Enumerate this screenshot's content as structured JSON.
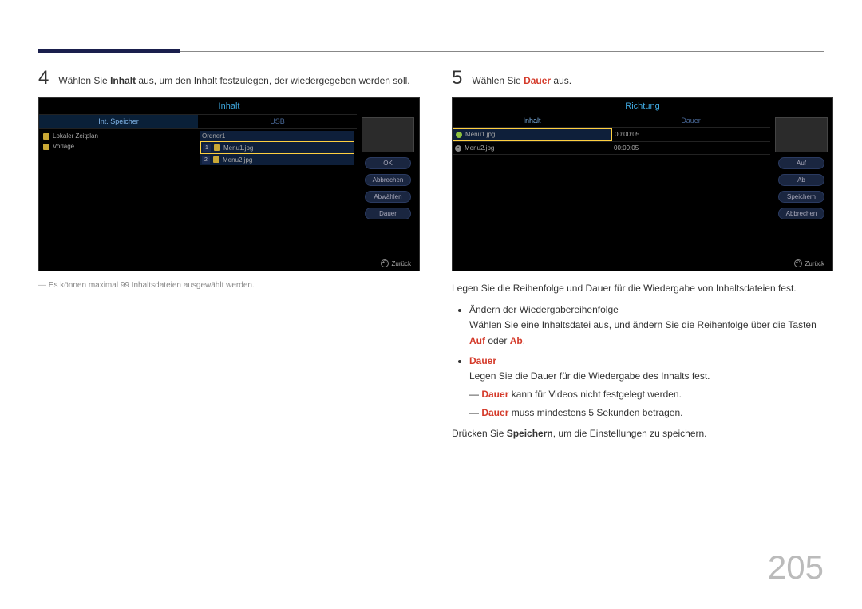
{
  "page_number": "205",
  "left": {
    "step_num": "4",
    "step_prefix": "Wählen Sie ",
    "step_bold": "Inhalt",
    "step_suffix": " aus, um den Inhalt festzulegen, der wiedergegeben werden soll.",
    "tv": {
      "title": "Inhalt",
      "tab1": "Int. Speicher",
      "tab2": "USB",
      "storage_items": [
        "Lokaler Zeitplan",
        "Vorlage"
      ],
      "usb_folder": "Ordner1",
      "usb_file1": "Menu1.jpg",
      "usb_file2": "Menu2.jpg",
      "btn_ok": "OK",
      "btn_cancel": "Abbrechen",
      "btn_deselect": "Abwählen",
      "btn_duration": "Dauer",
      "footer": "Zurück"
    },
    "note": "Es können maximal 99 Inhaltsdateien ausgewählt werden."
  },
  "right": {
    "step_num": "5",
    "step_prefix": "Wählen Sie ",
    "step_bold": "Dauer",
    "step_suffix": " aus.",
    "tv": {
      "title": "Richtung",
      "hdr1": "Inhalt",
      "hdr2": "Dauer",
      "row1_file": "Menu1.jpg",
      "row1_dur": "00:00:05",
      "row2_file": "Menu2.jpg",
      "row2_dur": "00:00:05",
      "btn_up": "Auf",
      "btn_down": "Ab",
      "btn_save": "Speichern",
      "btn_cancel": "Abbrechen",
      "footer": "Zurück"
    },
    "p1": "Legen Sie die Reihenfolge und Dauer für die Wiedergabe von Inhaltsdateien fest.",
    "b1_title": "Ändern der Wiedergabereihenfolge",
    "b1_text_prefix": "Wählen Sie eine Inhaltsdatei aus, und ändern Sie die Reihenfolge über die Tasten ",
    "b1_auf": "Auf",
    "b1_or": " oder ",
    "b1_ab": "Ab",
    "b1_period": ".",
    "b2_title": "Dauer",
    "b2_text": "Legen Sie die Dauer für die Wiedergabe des Inhalts fest.",
    "b2_n1_bold": "Dauer",
    "b2_n1_rest": " kann für Videos nicht festgelegt werden.",
    "b2_n2_bold": "Dauer",
    "b2_n2_rest": " muss mindestens 5 Sekunden betragen.",
    "p2_prefix": "Drücken Sie ",
    "p2_bold": "Speichern",
    "p2_suffix": ", um die Einstellungen zu speichern."
  }
}
